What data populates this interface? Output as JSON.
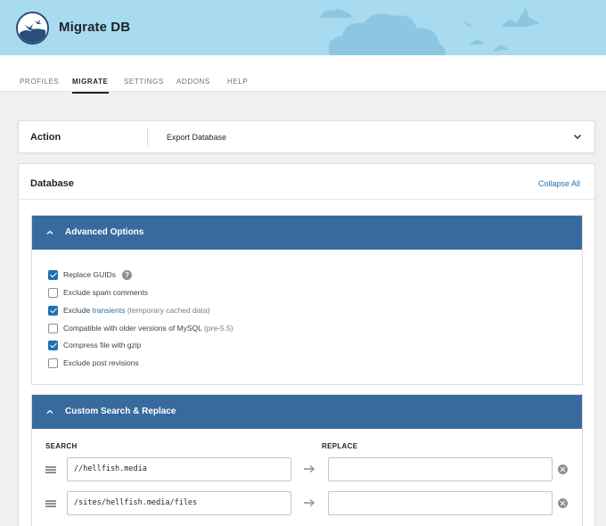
{
  "app": {
    "title": "Migrate DB"
  },
  "tabs": [
    {
      "label": "PROFILES",
      "active": false
    },
    {
      "label": "MIGRATE",
      "active": true
    },
    {
      "label": "SETTINGS",
      "active": false
    },
    {
      "label": "ADDONS",
      "active": false
    },
    {
      "label": "HELP",
      "active": false
    }
  ],
  "action": {
    "label": "Action",
    "value": "Export Database",
    "icon": "chevron-down-icon"
  },
  "database": {
    "title": "Database",
    "collapse_label": "Collapse All"
  },
  "advanced": {
    "title": "Advanced Options",
    "options": [
      {
        "label": "Replace GUIDs",
        "checked": true,
        "help_icon": "?"
      },
      {
        "label": "Exclude spam comments",
        "checked": false
      },
      {
        "label_pre": "Exclude ",
        "link": "transients",
        "note": " (temporary cached data)",
        "checked": true
      },
      {
        "label": "Compatible with older versions of MySQL ",
        "note": "(pre-5.5)",
        "checked": false
      },
      {
        "label": "Compress file with gzip",
        "checked": true
      },
      {
        "label": "Exclude post revisions",
        "checked": false
      }
    ]
  },
  "search_replace": {
    "title": "Custom Search & Replace",
    "search_header": "SEARCH",
    "replace_header": "REPLACE",
    "rows": [
      {
        "search": "//hellfish.media",
        "replace": ""
      },
      {
        "search": "/sites/hellfish.media/files",
        "replace": ""
      }
    ]
  },
  "colors": {
    "accent": "#386a9e",
    "header_bg": "#a8dbf0",
    "link": "#2271b1",
    "checkbox": "#2271b1"
  }
}
